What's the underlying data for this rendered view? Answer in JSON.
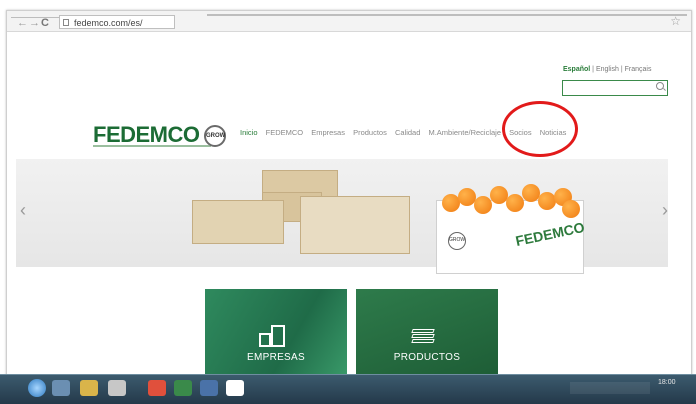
{
  "browser": {
    "url": "fedemco.com/es/",
    "nav_back": "←",
    "nav_forward": "→",
    "nav_reload": "C",
    "bookmark_star": "☆"
  },
  "languages": {
    "active": "Español",
    "items": [
      "English",
      "Français"
    ],
    "separator": " | "
  },
  "search": {
    "placeholder": ""
  },
  "header": {
    "logo_text": "FEDEMCO",
    "badge_text": "GROW"
  },
  "menu": {
    "items": [
      "Inicio",
      "FEDEMCO",
      "Empresas",
      "Productos",
      "Calidad",
      "M.Ambiente/Reciclaje",
      "Socios",
      "Noticias"
    ]
  },
  "hero": {
    "box_label": "FEDEMCO",
    "prev": "‹",
    "next": "›"
  },
  "tiles": [
    {
      "label": "EMPRESAS",
      "icon": "buildings-icon"
    },
    {
      "label": "PRODUCTOS",
      "icon": "stack-icon"
    }
  ],
  "taskbar": {
    "clock": "18:00"
  },
  "colors": {
    "brand_green": "#1c6c35",
    "highlight_red": "#e21a1a"
  }
}
